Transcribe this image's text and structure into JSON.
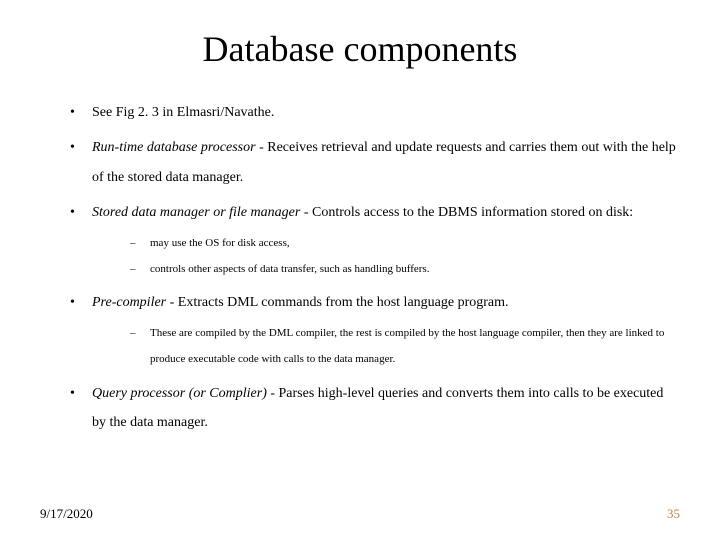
{
  "title": "Database components",
  "bullets": [
    {
      "plain": "See Fig 2. 3 in Elmasri/Navathe."
    },
    {
      "term": "Run-time database processor",
      "rest": " - Receives retrieval and update requests and carries them out with the help of the stored data manager."
    },
    {
      "term": "Stored data manager or file manager",
      "rest": " - Controls access to the DBMS information stored on disk:",
      "subs": [
        "may use the OS for disk access,",
        "controls other aspects of data transfer, such as handling buffers."
      ]
    },
    {
      "term": "Pre-compiler",
      "rest": " - Extracts DML commands from the host language program.",
      "subs": [
        "These are compiled by the DML compiler, the rest is compiled by the host language compiler, then they are linked to produce executable code with calls to the data manager."
      ]
    },
    {
      "term": "Query processor (or Complier)",
      "rest": " - Parses high-level queries and converts them into calls to be executed by the data manager."
    }
  ],
  "footer": {
    "date": "9/17/2020",
    "page": "35"
  }
}
